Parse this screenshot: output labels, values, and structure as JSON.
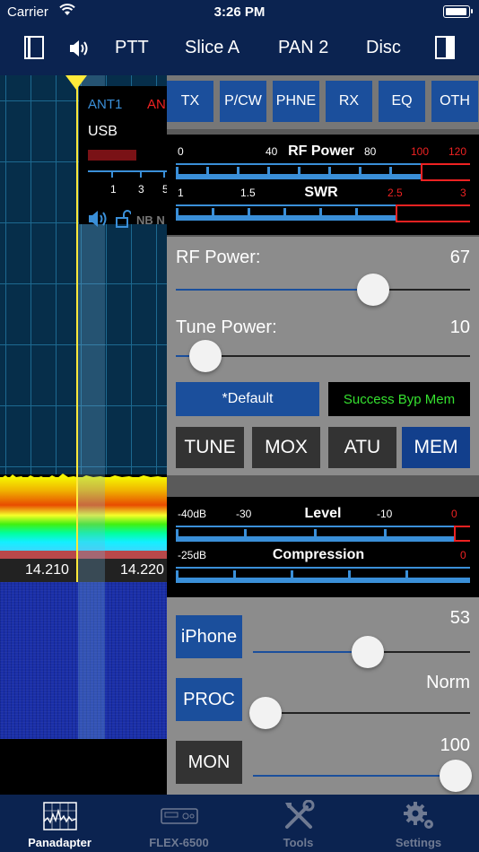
{
  "status_bar": {
    "carrier": "Carrier",
    "time": "3:26 PM"
  },
  "toolbar": {
    "ptt": "PTT",
    "slice": "Slice A",
    "pan": "PAN 2",
    "disc": "Disc"
  },
  "panadapter": {
    "freq_left": "14.210",
    "freq_right": "14.220",
    "slice_flag": {
      "ant_rx": "ANT1",
      "ant_tx": "AN",
      "mode": "USB",
      "scale": [
        "1",
        "3",
        "5"
      ],
      "nb": "NB N"
    }
  },
  "tx_tabs": [
    "TX",
    "P/CW",
    "PHNE",
    "RX",
    "EQ",
    "OTH"
  ],
  "rf_meter": {
    "title": "RF Power",
    "scale": [
      "0",
      "40",
      "80",
      "100",
      "120"
    ],
    "swr_title": "SWR",
    "swr_scale": [
      "1",
      "1.5",
      "2.5",
      "3"
    ]
  },
  "tx_controls": {
    "rf_power_label": "RF Power:",
    "rf_power_value": "67",
    "rf_power_level": 0.67,
    "tune_power_label": "Tune Power:",
    "tune_power_value": "10",
    "tune_power_level": 0.1,
    "profile": "*Default",
    "status": "Success Byp Mem",
    "buttons": [
      "TUNE",
      "MOX",
      "ATU",
      "MEM"
    ]
  },
  "level_meter": {
    "title": "Level",
    "scale": [
      "-40dB",
      "-30",
      "-10",
      "0"
    ],
    "comp_title": "Compression",
    "comp_scale": [
      "-25dB",
      "0"
    ]
  },
  "mic_controls": {
    "source": "iPhone",
    "source_value": "53",
    "source_level": 0.53,
    "proc": "PROC",
    "proc_value": "Norm",
    "proc_level": 0.0,
    "mon": "MON",
    "mon_value": "100",
    "mon_level": 1.0
  },
  "bottom_tabs": [
    "Panadapter",
    "FLEX-6500",
    "Tools",
    "Settings"
  ],
  "colors": {
    "accent_blue": "#1b4f9c",
    "nav": "#0b2350",
    "status_green": "#35e02f",
    "alert_red": "#e22222"
  }
}
